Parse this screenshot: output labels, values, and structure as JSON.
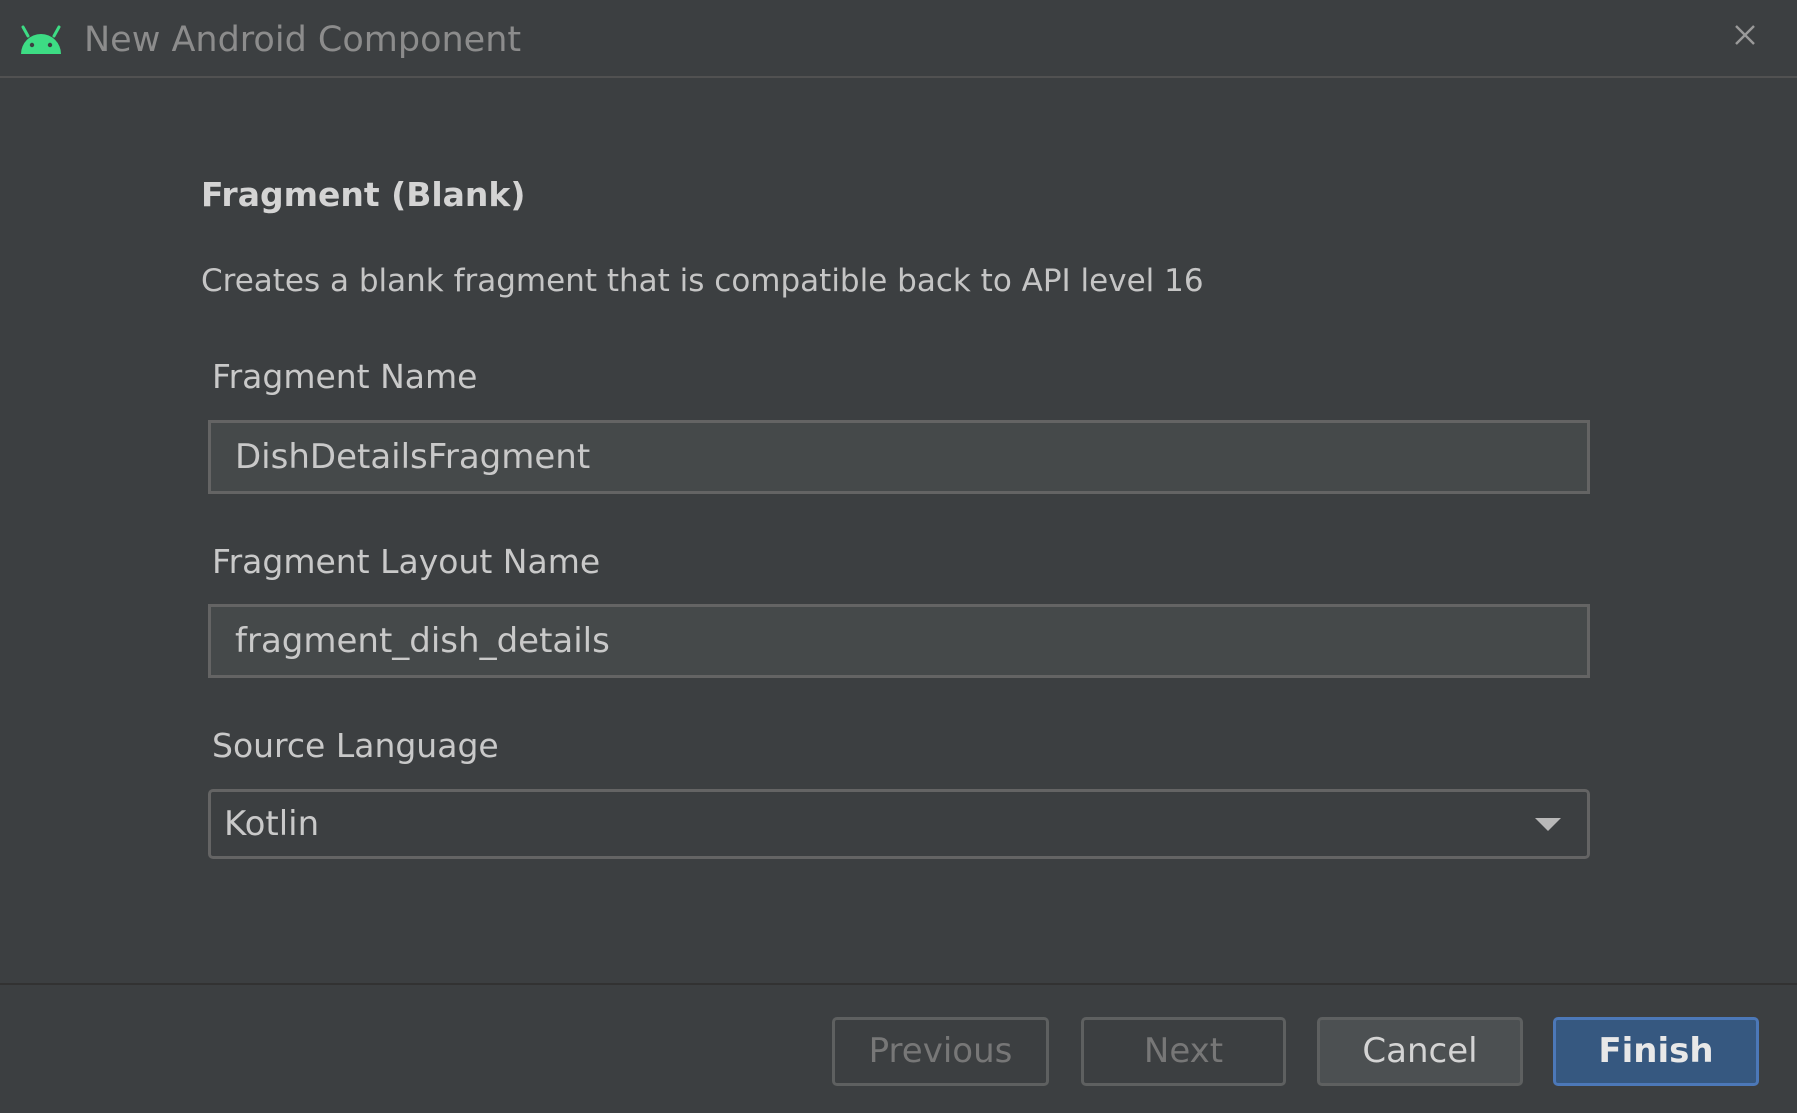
{
  "window": {
    "title": "New Android Component",
    "close_icon": "close-icon"
  },
  "template": {
    "heading": "Fragment (Blank)",
    "description": "Creates a blank fragment that is compatible back to API level 16"
  },
  "form": {
    "fragment_name": {
      "label": "Fragment Name",
      "value": "DishDetailsFragment"
    },
    "fragment_layout_name": {
      "label": "Fragment Layout Name",
      "value": "fragment_dish_details"
    },
    "source_language": {
      "label": "Source Language",
      "selected": "Kotlin"
    }
  },
  "buttons": {
    "previous": "Previous",
    "next": "Next",
    "cancel": "Cancel",
    "finish": "Finish"
  },
  "colors": {
    "android_green": "#3ddc84",
    "primary_button": "#365880",
    "background": "#3c3f41"
  }
}
